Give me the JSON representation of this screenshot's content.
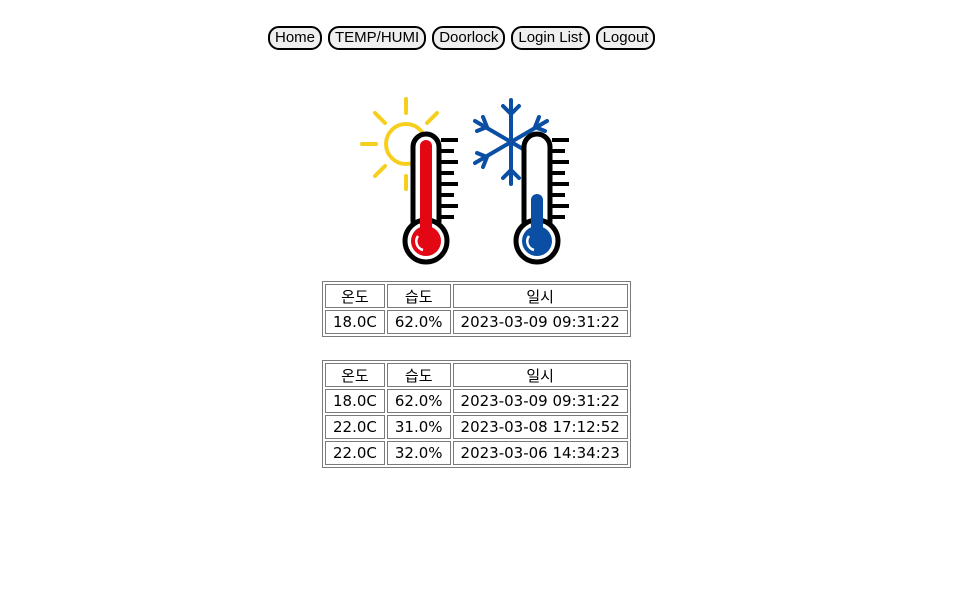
{
  "nav": {
    "buttons": [
      {
        "label": "Home"
      },
      {
        "label": "TEMP/HUMI"
      },
      {
        "label": "Doorlock"
      },
      {
        "label": "Login List"
      },
      {
        "label": "Logout"
      }
    ]
  },
  "hero": {
    "icon": "hot-cold-thermometers",
    "colors": {
      "sun": "#f6cf1e",
      "hot": "#e30613",
      "cold": "#0a4fa3"
    }
  },
  "current": {
    "headers": [
      "온도",
      "습도",
      "일시"
    ],
    "rows": [
      [
        "18.0C",
        "62.0%",
        "2023-03-09 09:31:22"
      ]
    ]
  },
  "history": {
    "headers": [
      "온도",
      "습도",
      "일시"
    ],
    "rows": [
      [
        "18.0C",
        "62.0%",
        "2023-03-09 09:31:22"
      ],
      [
        "22.0C",
        "31.0%",
        "2023-03-08 17:12:52"
      ],
      [
        "22.0C",
        "32.0%",
        "2023-03-06 14:34:23"
      ]
    ]
  }
}
